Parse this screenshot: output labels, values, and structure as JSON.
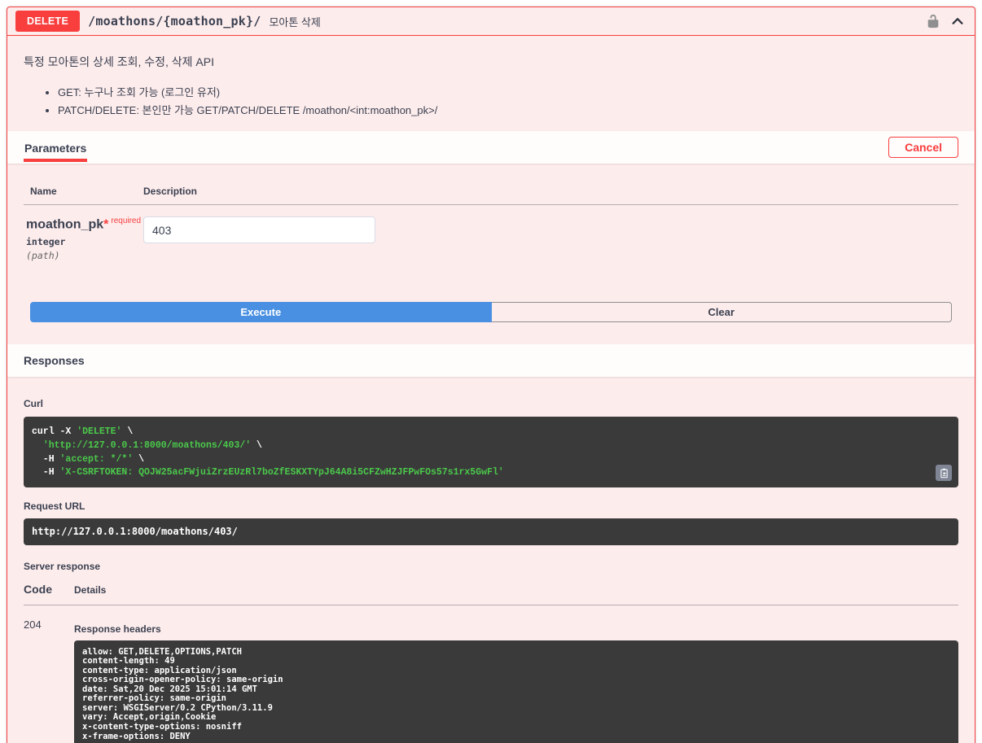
{
  "colors": {
    "accent_red": "#f93e3e",
    "block_background": "#fdecec",
    "execute_blue": "#4990e2",
    "code_background": "#3a3a3a",
    "code_string_green": "#4bc94b",
    "heading_text": "#3b4151"
  },
  "operation": {
    "method": "DELETE",
    "path": "/moathons/{moathon_pk}/",
    "summary": "모아톤 삭제"
  },
  "description": {
    "title": "특정 모아톤의 상세 조회, 수정, 삭제 API",
    "bullets": [
      "GET: 누구나 조회 가능 (로그인 유저)",
      "PATCH/DELETE: 본인만 가능 GET/PATCH/DELETE /moathon/<int:moathon_pk>/"
    ]
  },
  "parameters_section": {
    "tab_label": "Parameters",
    "cancel_label": "Cancel",
    "col_name": "Name",
    "col_description": "Description",
    "parameter": {
      "name": "moathon_pk",
      "required_star": "*",
      "required_label": "required",
      "type": "integer",
      "location": "(path)",
      "value": "403"
    },
    "execute_label": "Execute",
    "clear_label": "Clear"
  },
  "responses_section": {
    "title": "Responses",
    "curl": {
      "label": "Curl",
      "lines": [
        [
          {
            "t": "curl -X ",
            "c": "plain"
          },
          {
            "t": "'DELETE'",
            "c": "string"
          },
          {
            "t": " \\",
            "c": "plain"
          }
        ],
        [
          {
            "t": "  ",
            "c": "plain"
          },
          {
            "t": "'http://127.0.0.1:8000/moathons/403/'",
            "c": "string"
          },
          {
            "t": " \\",
            "c": "plain"
          }
        ],
        [
          {
            "t": "  -H ",
            "c": "plain"
          },
          {
            "t": "'accept: */*'",
            "c": "string"
          },
          {
            "t": " \\",
            "c": "plain"
          }
        ],
        [
          {
            "t": "  -H ",
            "c": "plain"
          },
          {
            "t": "'X-CSRFTOKEN: QOJW25acFWjuiZrzEUzRl7boZfESKXTYpJ64A8i5CFZwHZJFPwFOs57s1rx5GwFl'",
            "c": "string"
          }
        ]
      ]
    },
    "request_url_label": "Request URL",
    "request_url": "http://127.0.0.1:8000/moathons/403/",
    "server_response_label": "Server response",
    "code_label": "Code",
    "details_label": "Details",
    "response": {
      "code": "204",
      "headers_label": "Response headers",
      "headers_text": "allow: GET,DELETE,OPTIONS,PATCH\ncontent-length: 49\ncontent-type: application/json\ncross-origin-opener-policy: same-origin\ndate: Sat,20 Dec 2025 15:01:14 GMT\nreferrer-policy: same-origin\nserver: WSGIServer/0.2 CPython/3.11.9\nvary: Accept,origin,Cookie\nx-content-type-options: nosniff\nx-frame-options: DENY"
    }
  }
}
